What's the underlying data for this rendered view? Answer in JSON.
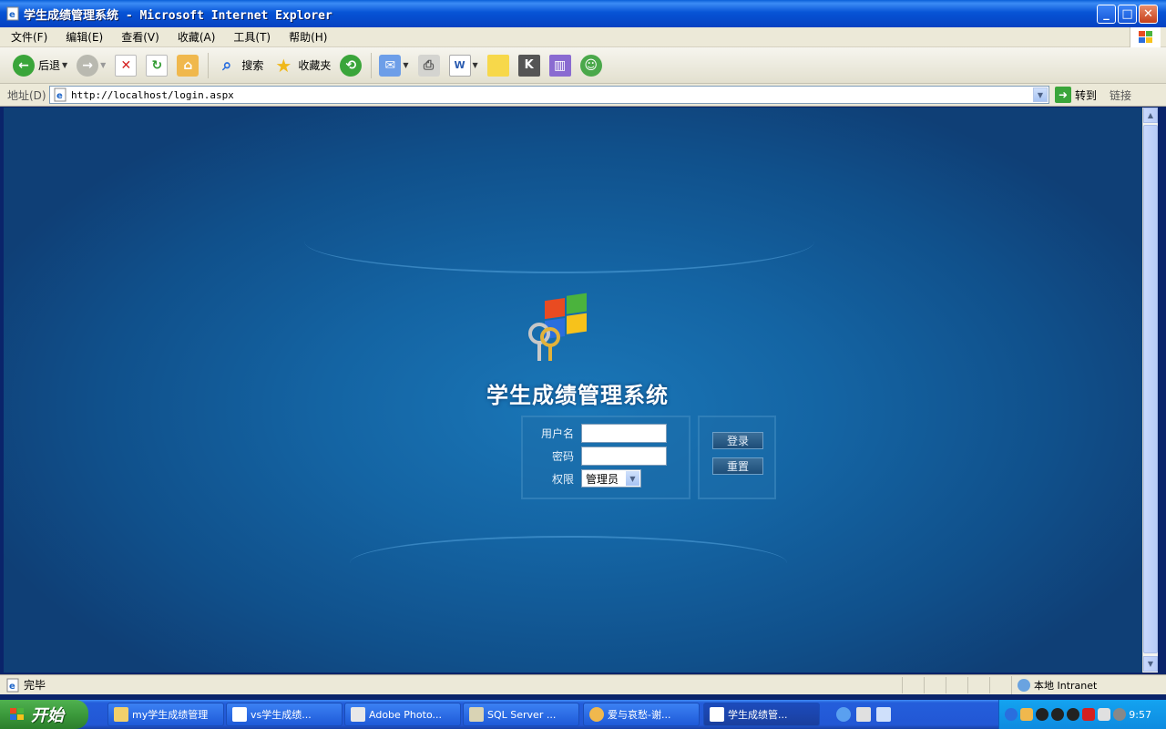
{
  "window": {
    "title": "学生成绩管理系统 - Microsoft Internet Explorer",
    "min_label": "_",
    "max_label": "□",
    "close_label": "✕"
  },
  "menu": [
    "文件(F)",
    "编辑(E)",
    "查看(V)",
    "收藏(A)",
    "工具(T)",
    "帮助(H)"
  ],
  "toolbar": {
    "back_label": "后退",
    "search_label": "搜索",
    "favorites_label": "收藏夹"
  },
  "address": {
    "label": "地址(D)",
    "url": "http://localhost/login.aspx",
    "go_label": "转到",
    "links_label": "链接"
  },
  "login": {
    "system_title": "学生成绩管理系统",
    "username_label": "用户名",
    "password_label": "密码",
    "role_label": "权限",
    "role_selected": "管理员",
    "login_button": "登录",
    "reset_button": "重置"
  },
  "status": {
    "text": "完毕",
    "zone": "本地 Intranet"
  },
  "taskbar": {
    "start_label": "开始",
    "tasks": [
      "my学生成绩管理",
      "vs学生成绩...",
      "Adobe Photo...",
      "SQL Server ...",
      "爱与哀愁-谢...",
      "学生成绩管..."
    ],
    "clock": "9:57"
  },
  "colors": {
    "titlebar": "#0754d6",
    "content_bg": "#1464a3",
    "taskbar": "#245edb",
    "start_button": "#3c9a3c"
  }
}
